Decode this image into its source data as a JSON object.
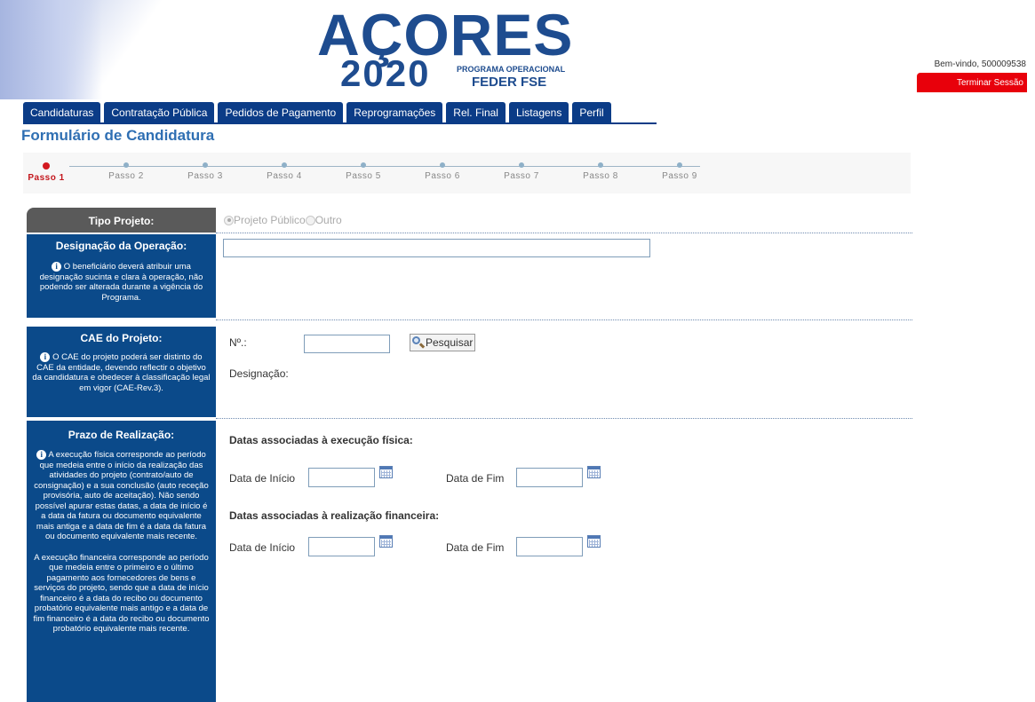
{
  "header": {
    "logo_top": "AÇORES",
    "logo_year": "2020",
    "logo_program": "PROGRAMA OPERACIONAL",
    "logo_fund": "FEDER FSE",
    "welcome": "Bem-vindo, 500009538",
    "logout": "Terminar Sessão"
  },
  "tabs": [
    "Candidaturas",
    "Contratação Pública",
    "Pedidos de Pagamento",
    "Reprogramações",
    "Rel. Final",
    "Listagens",
    "Perfil"
  ],
  "page_title": "Formulário de Candidatura",
  "steps": [
    "Passo 1",
    "Passo 2",
    "Passo 3",
    "Passo 4",
    "Passo 5",
    "Passo 6",
    "Passo 7",
    "Passo 8",
    "Passo 9"
  ],
  "active_step": "Passo 1",
  "sections": {
    "tipo": {
      "title": "Tipo Projeto:",
      "options": [
        "Projeto Público",
        "Outro"
      ],
      "selected": "Projeto Público"
    },
    "designacao": {
      "title": "Designação da Operação:",
      "info": "O beneficiário deverá atribuir uma designação sucinta e clara à operação, não podendo ser alterada durante a vigência do Programa.",
      "value": ""
    },
    "cae": {
      "title": "CAE do Projeto:",
      "info": "O CAE do projeto poderá ser distinto do CAE da entidade, devendo reflectir o objetivo da candidatura e obedecer à classificação legal em vigor (CAE-Rev.3).",
      "num_label": "Nº.:",
      "num_value": "",
      "search_label": "Pesquisar",
      "designacao_label": "Designação:"
    },
    "prazo": {
      "title": "Prazo de Realização:",
      "info1": "A execução física corresponde ao período que medeia entre o início da realização das atividades do projeto (contrato/auto de consignação) e a sua conclusão (auto receção provisória, auto de aceitação). Não sendo possível apurar estas datas, a data de início é a data da fatura ou documento equivalente mais antiga e a data de fim é a data da fatura ou documento equivalente mais recente.",
      "info2": "A execução financeira corresponde ao período que medeia entre o primeiro e o último pagamento aos fornecedores de bens e serviços do projeto, sendo que a data de início financeiro é a data do recibo ou documento probatório equivalente mais antigo e a data de fim financeiro é a data do recibo ou documento probatório equivalente mais recente.",
      "fisica_heading": "Datas associadas à execução física:",
      "financeira_heading": "Datas associadas à realização financeira:",
      "start_label": "Data de Início",
      "end_label": "Data de Fim",
      "fisica_start": "",
      "fisica_end": "",
      "financeira_start": "",
      "financeira_end": ""
    }
  },
  "colors": {
    "nav_blue": "#0b3c87",
    "side_blue": "#0b4a8a",
    "title_blue": "#2f6fb3",
    "logout_red": "#e8000b",
    "active_step_red": "#d31920"
  }
}
